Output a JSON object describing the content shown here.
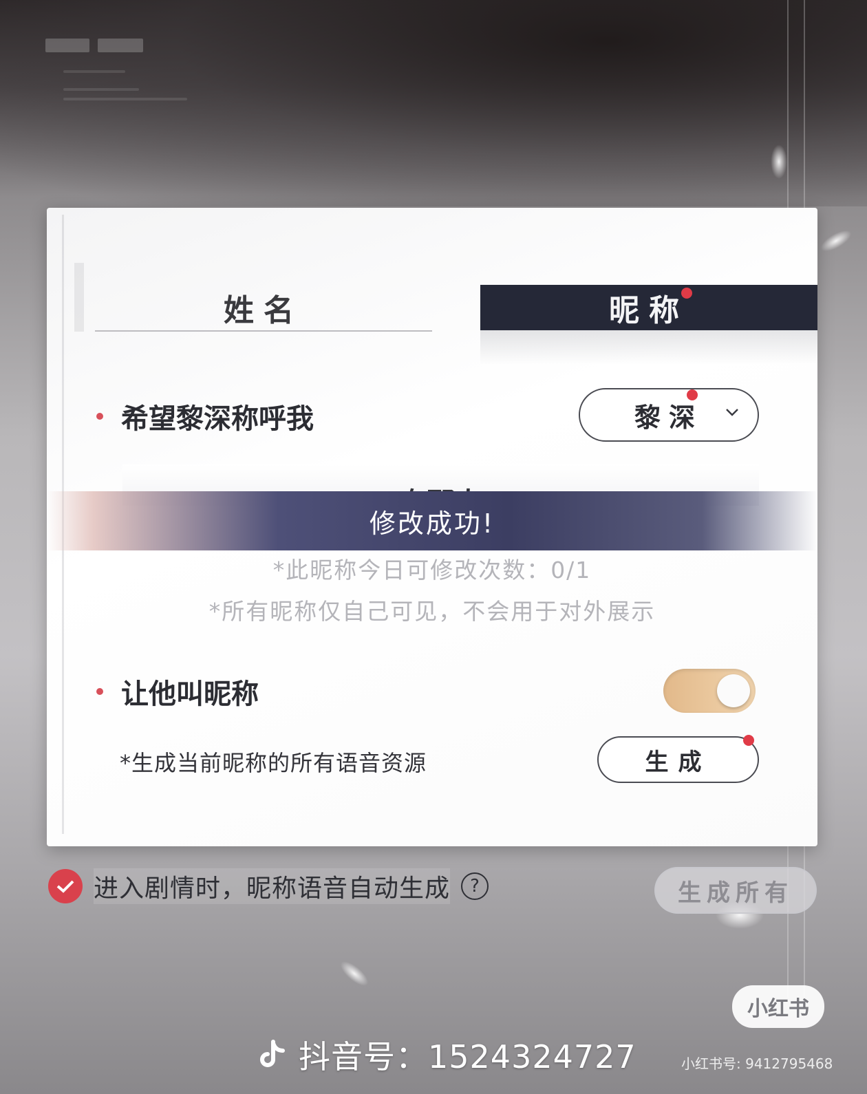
{
  "tabs": {
    "name": "姓名",
    "nickname": "昵称"
  },
  "call_me": {
    "label": "希望黎深称呼我",
    "selected": "黎深",
    "input_value": "专那人"
  },
  "toast": "修改成功!",
  "hints": {
    "daily_limit": "*此昵称今日可修改次数：0/1",
    "visibility": "*所有昵称仅自己可见，不会用于对外展示"
  },
  "nickname_toggle": {
    "label": "让他叫昵称",
    "on": true
  },
  "generate": {
    "label": "*生成当前昵称的所有语音资源",
    "button": "生成"
  },
  "auto_generate": {
    "label": "进入剧情时，昵称语音自动生成",
    "checked": true,
    "help": "?"
  },
  "generate_all": "生成所有",
  "watermarks": {
    "xiaohongshu_badge": "小红书",
    "douyin": "抖音号：1524324727",
    "xiaohongshu_id": "小红书号: 9412795468"
  },
  "colors": {
    "accent_red": "#e03b47",
    "tab_dark": "#252837",
    "toggle_on": "#e2b98a"
  }
}
